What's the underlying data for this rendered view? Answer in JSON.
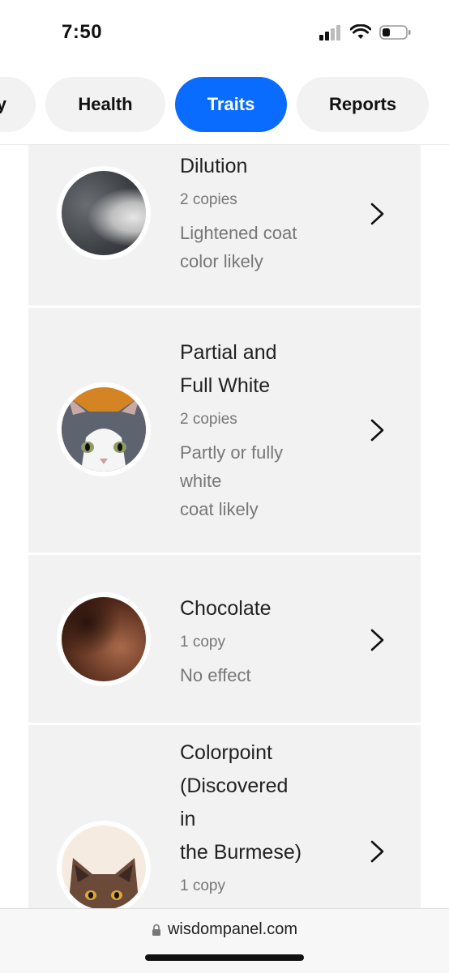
{
  "status_bar": {
    "time": "7:50"
  },
  "tabs": [
    {
      "label": "y"
    },
    {
      "label": "Health"
    },
    {
      "label": "Traits",
      "active": true
    },
    {
      "label": "Reports"
    }
  ],
  "traits": [
    {
      "title": "Dilution",
      "copies": "2 copies",
      "effect": "Lightened coat\ncolor likely",
      "image_icon": "gray-fur-image"
    },
    {
      "title": "Partial and\nFull White",
      "copies": "2 copies",
      "effect": "Partly or fully\nwhite\ncoat likely",
      "image_icon": "gray-white-kitten-image"
    },
    {
      "title": "Chocolate",
      "copies": "1 copy",
      "effect": "No effect",
      "image_icon": "brown-fur-image"
    },
    {
      "title": "Colorpoint\n(Discovered\nin\nthe Burmese)",
      "copies": "1 copy",
      "image_icon": "burmese-cat-image"
    }
  ],
  "browser": {
    "url": "wisdompanel.com"
  },
  "colors": {
    "accent": "#0a6cff",
    "card_bg": "#f2f2f2"
  }
}
